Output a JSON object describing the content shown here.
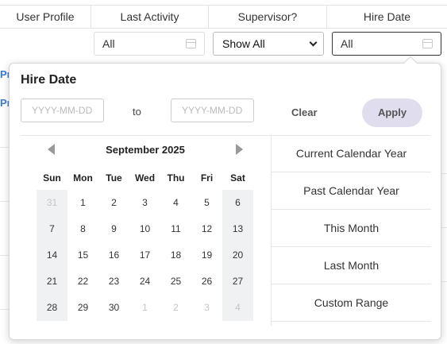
{
  "columns": {
    "user_profile": "User Profile",
    "last_activity": "Last Activity",
    "supervisor": "Supervisor?",
    "hire_date": "Hire Date"
  },
  "filters": {
    "last_activity": "All",
    "supervisor": "Show All",
    "hire_date": "All"
  },
  "background_links": [
    "Pr",
    "Pr"
  ],
  "popup": {
    "title": "Hire Date",
    "from_placeholder": "YYYY-MM-DD",
    "to_label": "to",
    "to_placeholder": "YYYY-MM-DD",
    "clear_label": "Clear",
    "apply_label": "Apply",
    "month_label": "September 2025",
    "weekdays": [
      "Sun",
      "Mon",
      "Tue",
      "Wed",
      "Thu",
      "Fri",
      "Sat"
    ],
    "weeks": [
      [
        "31",
        "1",
        "2",
        "3",
        "4",
        "5",
        "6"
      ],
      [
        "7",
        "8",
        "9",
        "10",
        "11",
        "12",
        "13"
      ],
      [
        "14",
        "15",
        "16",
        "17",
        "18",
        "19",
        "20"
      ],
      [
        "21",
        "22",
        "23",
        "24",
        "25",
        "26",
        "27"
      ],
      [
        "28",
        "29",
        "30",
        "1",
        "2",
        "3",
        "4"
      ]
    ],
    "ranges": [
      "Current Calendar Year",
      "Past Calendar Year",
      "This Month",
      "Last Month",
      "Custom Range"
    ]
  },
  "colors": {
    "apply_bg": "#e0deee",
    "weekend_bg": "#f0f1f3",
    "link": "#3a7bd5"
  },
  "icons": {
    "calendar": "calendar-icon",
    "prev": "chevron-left-icon",
    "next": "chevron-right-icon",
    "dropdown": "chevron-down-icon"
  }
}
